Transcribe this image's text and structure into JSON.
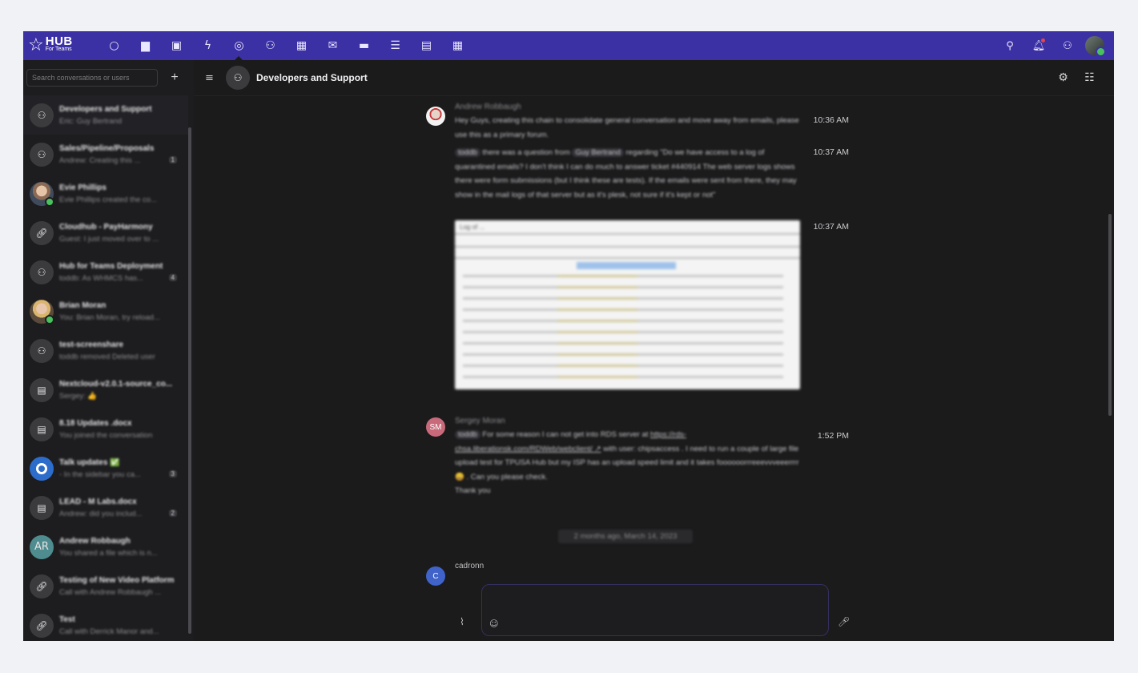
{
  "app": {
    "logo_text": "HUB",
    "logo_subtext": "For Teams"
  },
  "topbar": {
    "app_icons": [
      "dashboard-icon",
      "files-icon",
      "photos-icon",
      "activity-icon",
      "talk-icon",
      "contacts-icon",
      "calendar-icon",
      "mail-icon",
      "deck-icon",
      "tasks-icon",
      "forms-icon",
      "appointments-icon"
    ],
    "active_app": "talk-icon",
    "right_icons": [
      "search-icon",
      "notifications-icon",
      "contacts-menu-icon",
      "user-avatar"
    ]
  },
  "sidebar": {
    "search_placeholder": "Search conversations or users",
    "conversations": [
      {
        "name": "Developers and Support",
        "preview": "Eric: Guy Bertrand",
        "avatar": "group",
        "active": true
      },
      {
        "name": "Sales/Pipeline/Proposals",
        "preview": "Andrew: Creating this ...",
        "avatar": "group",
        "badge": "1"
      },
      {
        "name": "Evie Phillips",
        "preview": "Evie Phillips created the co...",
        "avatar": "photo",
        "online": true
      },
      {
        "name": "Cloudhub - PayHarmony",
        "preview": "Guest: I just moved over to ...",
        "avatar": "link"
      },
      {
        "name": "Hub for Teams Deployment",
        "preview": "toddb: As WHMCS has...",
        "avatar": "group",
        "badge": "4"
      },
      {
        "name": "Brian Moran",
        "preview": "You: Brian Moran, try reload...",
        "avatar": "photo2",
        "online": true
      },
      {
        "name": "test-screenshare",
        "preview": "toddb removed Deleted user",
        "avatar": "group"
      },
      {
        "name": "Nextcloud-v2.0.1-source_co...",
        "preview": "Sergey: 👍",
        "avatar": "file"
      },
      {
        "name": "8.18 Updates .docx",
        "preview": "You joined the conversation",
        "avatar": "file"
      },
      {
        "name": "Talk updates ✅",
        "preview": "- In the sidebar you ca...",
        "avatar": "talk",
        "badge": "3"
      },
      {
        "name": "LEAD - M Labs.docx",
        "preview": "Andrew: did you includ...",
        "avatar": "file",
        "badge": "2"
      },
      {
        "name": "Andrew Robbaugh",
        "preview": "You shared a file which is n...",
        "avatar": "initials",
        "initials": "AR"
      },
      {
        "name": "Testing of New Video Platform",
        "preview": "Call with Andrew Robbaugh ...",
        "avatar": "link"
      },
      {
        "name": "Test",
        "preview": "Call with Derrick Manor and...",
        "avatar": "link"
      }
    ]
  },
  "header": {
    "room_title": "Developers and Support",
    "right_icons": [
      "settings-icon",
      "sidebar-toggle-icon"
    ]
  },
  "messages": [
    {
      "author": "Andrew Robbaugh",
      "text": "Hey Guys, creating this chain to consolidate general conversation and move away from emails, please use this as a primary forum.",
      "time": "10:36 AM"
    },
    {
      "mention1": "toddb",
      "text_a": "there was a question from",
      "mention2": "Guy Bertrand",
      "text_b": "regarding \"Do we have access to a log of quarantined emails? I don't think I can do much to answer ticket #440914 The web server logs shows there were form submissions (but I think these are tests). If the emails were sent from there, they may show in the mail logs of that server but as it's plesk, not sure if it's kept or not\"",
      "time": "10:37 AM"
    },
    {
      "attachment_title": "Log of ...",
      "time": "10:37 AM"
    },
    {
      "author": "Sergey Moran",
      "initials": "SM",
      "mention": "toddb",
      "text_a": "For some reason I can not get into RDS server at",
      "link": "https://rds-chsa.liberationsk.com/RDWeb/webclient/ ↗",
      "text_b": "with user: chipsaccess . I need to run a couple of large file upload test for TPUSA Hub but my ISP has an upload speed limit and it takes foooooorrreeevvveeerrrr 😀 . Can you please check.",
      "text_c": "Thank you",
      "time": "1:52 PM"
    }
  ],
  "date_separator": "2 months ago, March 14, 2023",
  "last_author": {
    "name": "cadronn",
    "initials": "C"
  },
  "composer": {
    "placeholder": ""
  }
}
